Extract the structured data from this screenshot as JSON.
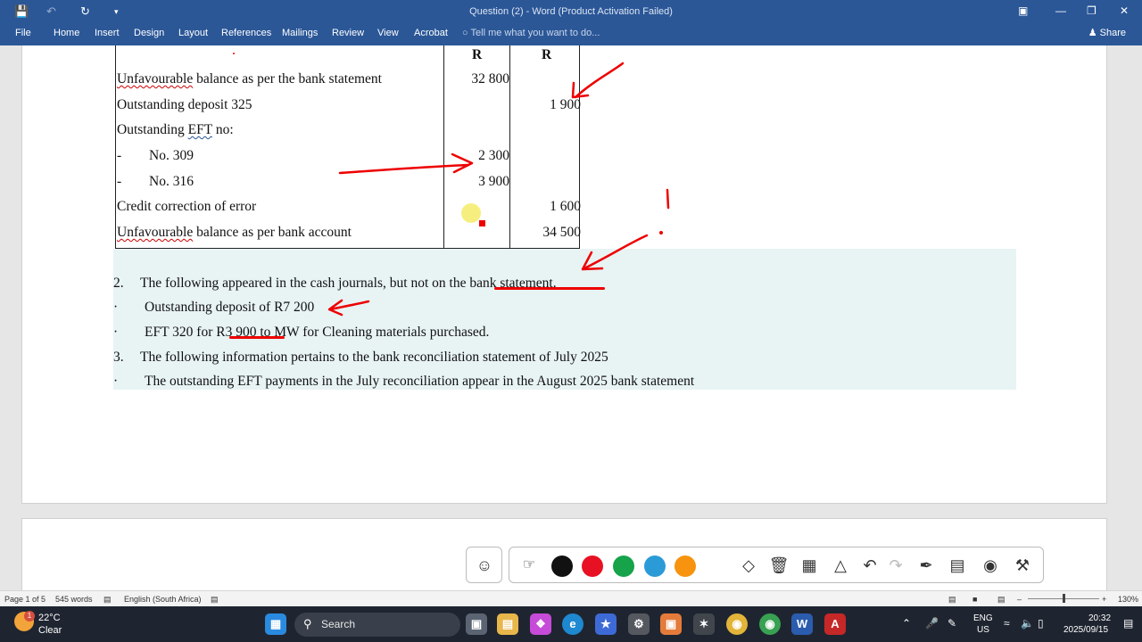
{
  "titlebar": {
    "title": "Question (2) - Word (Product Activation Failed)",
    "icons": [
      "save-icon",
      "undo-icon",
      "redo-icon",
      "customize-quick-access-icon"
    ]
  },
  "ribbon": {
    "tabs": [
      "File",
      "Home",
      "Insert",
      "Design",
      "Layout",
      "References",
      "Mailings",
      "Review",
      "View",
      "Acrobat"
    ],
    "tell_me": "Tell me what you want to do...",
    "share": "Share"
  },
  "table": {
    "col_headers": [
      "R",
      "R"
    ],
    "rows": [
      {
        "label": "Unfavourable balance as per the bank statement",
        "col1": "32 800",
        "col2": ""
      },
      {
        "label": "Outstanding deposit 325",
        "col1": "",
        "col2": "1 900"
      },
      {
        "label": "Outstanding EFT no:",
        "col1": "",
        "col2": ""
      },
      {
        "label": "No. 309",
        "prefix": "-",
        "col1": "2 300",
        "col2": ""
      },
      {
        "label": "No. 316",
        "prefix": "-",
        "col1": "3 900",
        "col2": ""
      },
      {
        "label": "Credit correction of error",
        "col1": "",
        "col2": "1 600"
      },
      {
        "label": "Unfavourable balance as per bank account",
        "col1": "",
        "col2": "34 500"
      }
    ]
  },
  "notes": {
    "item2_num": "2.",
    "item2_text": "The following appeared in the cash journals, but not on the bank statement.",
    "bullet1": "Outstanding deposit of R7 200",
    "bullet2": "EFT 320 for R3 900 to MW for Cleaning materials purchased.",
    "item3_num": "3.",
    "item3_text": "The following information pertains to the bank reconciliation statement of July 2025",
    "bullet3": "The outstanding EFT payments in the July reconciliation appear in the August 2025 bank statement",
    "bullet_char": "·"
  },
  "pen_toolbar": {
    "colors": [
      "#111111",
      "#e81123",
      "#16a34a",
      "#2b9bd8",
      "#f7930e"
    ],
    "tools": [
      "emoji-icon",
      "select-icon",
      "eraser-icon",
      "delete-icon",
      "screen-select-icon",
      "shapes-icon",
      "undo-icon",
      "redo-icon",
      "pin-icon",
      "calendar-icon",
      "camera-icon",
      "settings-icon"
    ]
  },
  "statusbar": {
    "page": "Page 1 of 5",
    "words": "545 words",
    "language": "English (South Africa)",
    "zoom": "130%"
  },
  "taskbar": {
    "weather_temp": "22°C",
    "weather_desc": "Clear",
    "weather_badge": "1",
    "search": "Search",
    "lang_top": "ENG",
    "lang_bottom": "US",
    "time": "20:32",
    "date": "2025/09/15"
  }
}
